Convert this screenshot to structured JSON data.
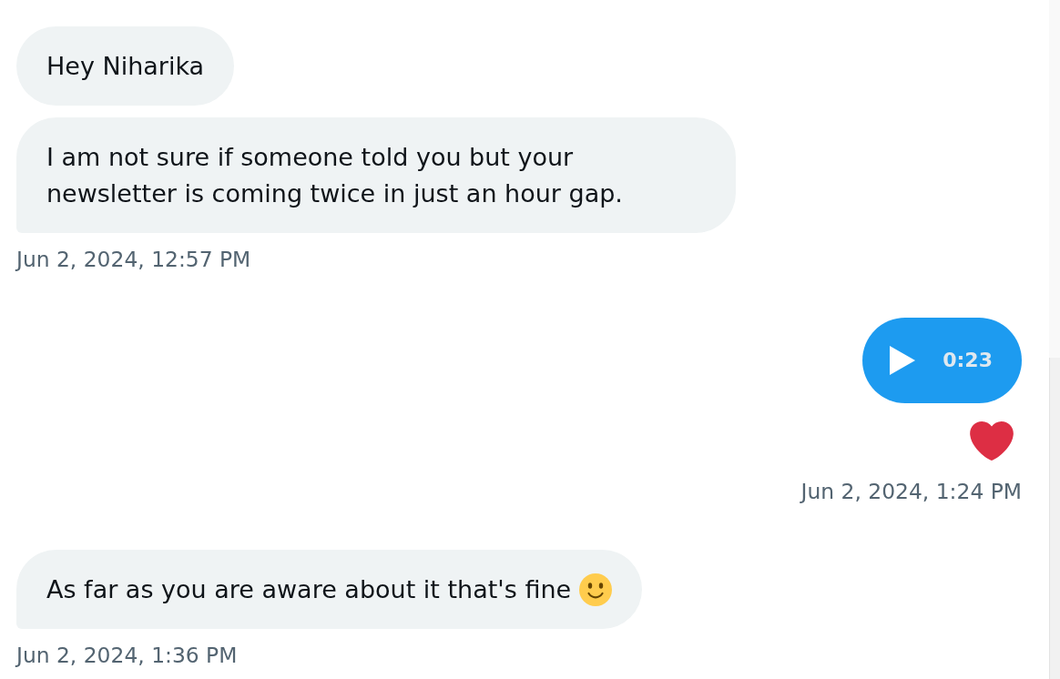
{
  "messages": [
    {
      "kind": "text",
      "sent": false,
      "text": "Hey Niharika",
      "liked": false
    },
    {
      "kind": "text",
      "sent": false,
      "text": "I am not sure if someone told you but your newsletter is coming twice in just an hour gap.",
      "liked": false,
      "timestamp": "Jun 2, 2024, 12:57 PM"
    },
    {
      "kind": "voice",
      "sent": true,
      "duration": "0:23",
      "liked": true,
      "timestamp": "Jun 2, 2024, 1:24 PM"
    },
    {
      "kind": "text",
      "sent": false,
      "text": "As far as you are aware about it that's fine",
      "emojis": [
        {
          "kind": "smiley"
        }
      ],
      "liked": false,
      "timestamp": "Jun 2, 2024, 1:36 PM"
    }
  ]
}
